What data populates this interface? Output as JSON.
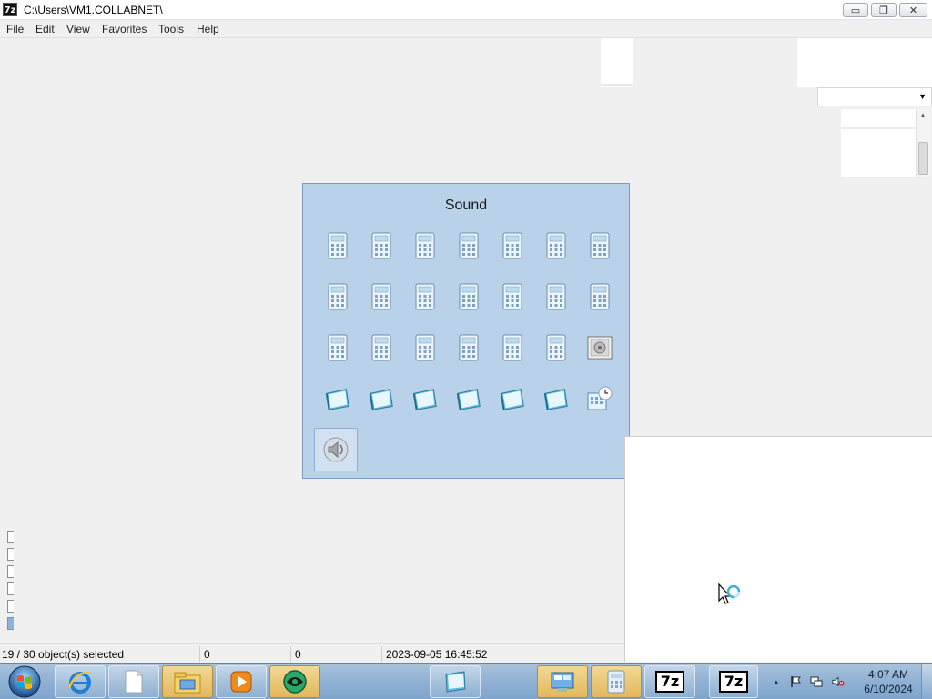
{
  "window": {
    "app_icon_text": "7z",
    "title": "C:\\Users\\VM1.COLLABNET\\",
    "minimize_glyph": "▭",
    "maximize_glyph": "❐",
    "close_glyph": "✕"
  },
  "menu": {
    "items": [
      {
        "label": "File"
      },
      {
        "label": "Edit"
      },
      {
        "label": "View"
      },
      {
        "label": "Favorites"
      },
      {
        "label": "Tools"
      },
      {
        "label": "Help"
      }
    ]
  },
  "combo": {
    "arrow_glyph": "▼"
  },
  "scrollbar": {
    "up_glyph": "▲"
  },
  "popup": {
    "title": "Sound",
    "icons": [
      "calculator-icon",
      "calculator-icon",
      "calculator-icon",
      "calculator-icon",
      "calculator-icon",
      "calculator-icon",
      "calculator-icon",
      "calculator-icon",
      "calculator-icon",
      "calculator-icon",
      "calculator-icon",
      "calculator-icon",
      "calculator-icon",
      "calculator-icon",
      "calculator-icon",
      "calculator-icon",
      "calculator-icon",
      "calculator-icon",
      "calculator-icon",
      "calculator-icon",
      "speaker-box-icon",
      "notepad-icon",
      "notepad-icon",
      "notepad-icon",
      "notepad-icon",
      "notepad-icon",
      "notepad-icon",
      "calendar-clock-icon",
      "sound-icon"
    ],
    "selected_index": 28
  },
  "statusbar": {
    "selection": "19 / 30 object(s) selected",
    "size": "0",
    "packed": "0",
    "modified": "2023-09-05 16:45:52"
  },
  "taskbar": {
    "buttons": [
      {
        "icon": "internet-explorer-icon"
      },
      {
        "icon": "document-icon"
      },
      {
        "icon": "file-explorer-icon"
      },
      {
        "icon": "media-player-icon"
      },
      {
        "icon": "green-orb-app-icon"
      },
      {
        "icon": "notepad-icon"
      },
      {
        "icon": "control-panel-icon"
      },
      {
        "icon": "calculator-icon"
      },
      {
        "icon": "seven-zip-icon",
        "text": "7z"
      },
      {
        "icon": "seven-zip-icon",
        "text": "7z"
      }
    ],
    "tray": {
      "show_hidden_glyph": "▲",
      "time": "4:07 AM",
      "date": "6/10/2024"
    }
  }
}
